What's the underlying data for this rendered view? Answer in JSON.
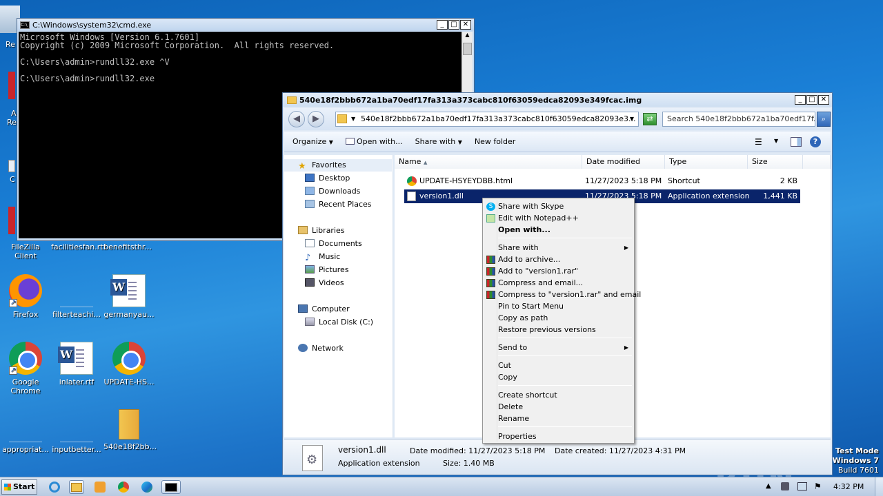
{
  "desktop": {
    "icons": [
      {
        "label": "Re",
        "name": "recycle-bin"
      },
      {
        "label": "A",
        "name": "app-a"
      },
      {
        "label": "Re",
        "name": "app-re"
      },
      {
        "label": "C",
        "name": "app-c"
      },
      {
        "label": "FileZilla Client",
        "name": "filezilla"
      },
      {
        "label": "facilitiesfan.rtf",
        "name": "facilitiesfan"
      },
      {
        "label": "benefitsthr...",
        "name": "benefitsthr"
      },
      {
        "label": "Firefox",
        "name": "firefox"
      },
      {
        "label": "filterteachi...",
        "name": "filterteachi"
      },
      {
        "label": "germanyau...",
        "name": "germanyau"
      },
      {
        "label": "Google Chrome",
        "name": "google-chrome"
      },
      {
        "label": "inlater.rtf",
        "name": "inlater"
      },
      {
        "label": "UPDATE-HS...",
        "name": "update-hs"
      },
      {
        "label": "appropriat...",
        "name": "appropriat"
      },
      {
        "label": "inputbetter...",
        "name": "inputbetter"
      },
      {
        "label": "540e18f2bb...",
        "name": "img-file"
      }
    ],
    "watermark": {
      "line1": "Test Mode",
      "line2": "Windows 7",
      "line3": "Build 7601"
    },
    "brand": "ANY RUN"
  },
  "cmd": {
    "title": "C:\\Windows\\system32\\cmd.exe",
    "lines": [
      "Microsoft Windows [Version 6.1.7601]",
      "Copyright (c) 2009 Microsoft Corporation.  All rights reserved.",
      "",
      "C:\\Users\\admin>rundll32.exe ^V",
      "",
      "C:\\Users\\admin>rundll32.exe"
    ]
  },
  "explorer": {
    "title": "540e18f2bbb672a1ba70edf17fa313a373cabc810f63059edca82093e349fcac.img",
    "address": "540e18f2bbb672a1ba70edf17fa313a373cabc810f63059edca82093e3...",
    "search_placeholder": "Search 540e18f2bbb672a1ba70edf17f...",
    "toolbar": {
      "organize": "Organize",
      "open_with": "Open with...",
      "share_with": "Share with",
      "new_folder": "New folder"
    },
    "nav": {
      "favorites": "Favorites",
      "desktop": "Desktop",
      "downloads": "Downloads",
      "recent": "Recent Places",
      "libraries": "Libraries",
      "documents": "Documents",
      "music": "Music",
      "pictures": "Pictures",
      "videos": "Videos",
      "computer": "Computer",
      "local_disk": "Local Disk (C:)",
      "network": "Network"
    },
    "columns": {
      "name": "Name",
      "date": "Date modified",
      "type": "Type",
      "size": "Size"
    },
    "files": [
      {
        "name": "UPDATE-HSYEYDBB.html",
        "date": "11/27/2023 5:18 PM",
        "type": "Shortcut",
        "size": "2 KB"
      },
      {
        "name": "version1.dll",
        "date": "11/27/2023 5:18 PM",
        "type": "Application extension",
        "size": "1,441 KB"
      }
    ],
    "details": {
      "name": "version1.dll",
      "type": "Application extension",
      "modified_label": "Date modified:",
      "modified": "11/27/2023 5:18 PM",
      "size_label": "Size:",
      "size": "1.40 MB",
      "created_label": "Date created:",
      "created": "11/27/2023 4:31 PM"
    }
  },
  "context_menu": {
    "share_skype": "Share with Skype",
    "edit_notepad": "Edit with Notepad++",
    "open_with": "Open with...",
    "share_with": "Share with",
    "add_archive": "Add to archive...",
    "add_rar": "Add to \"version1.rar\"",
    "compress_email": "Compress and email...",
    "compress_rar_email": "Compress to \"version1.rar\" and email",
    "pin_start": "Pin to Start Menu",
    "copy_path": "Copy as path",
    "restore": "Restore previous versions",
    "send_to": "Send to",
    "cut": "Cut",
    "copy": "Copy",
    "create_shortcut": "Create shortcut",
    "delete": "Delete",
    "rename": "Rename",
    "properties": "Properties"
  },
  "taskbar": {
    "start": "Start",
    "clock": "4:32 PM"
  }
}
